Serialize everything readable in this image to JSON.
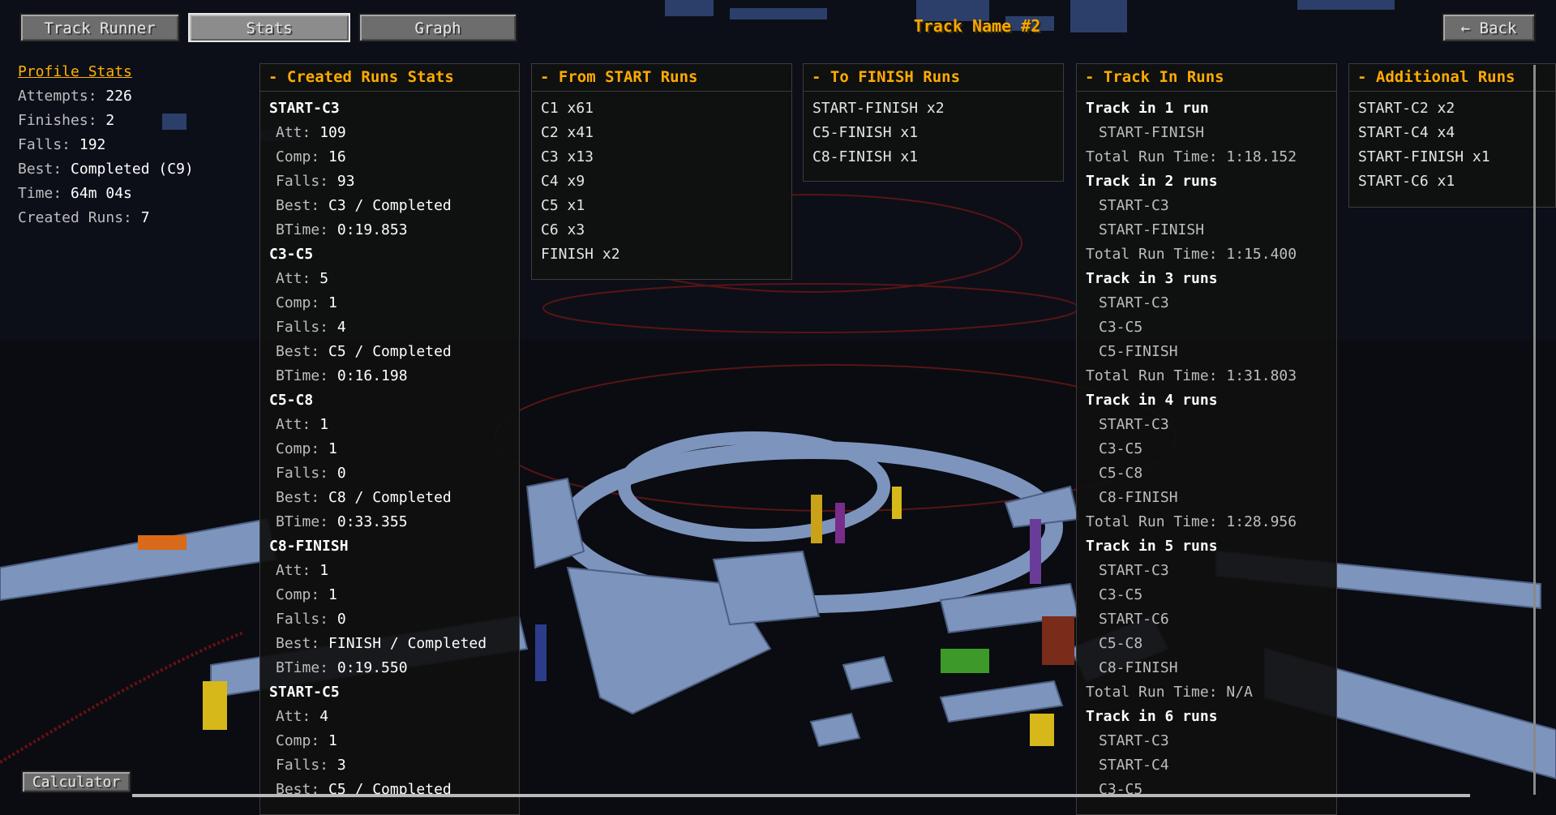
{
  "nav": {
    "track_runner": "Track Runner",
    "stats": "Stats",
    "graph": "Graph",
    "back": "← Back"
  },
  "track_title": "Track Name #2",
  "profile": {
    "header": "Profile Stats",
    "rows": [
      {
        "label": "Attempts: ",
        "value": "226"
      },
      {
        "label": "Finishes: ",
        "value": "2"
      },
      {
        "label": "Falls: ",
        "value": "192"
      },
      {
        "label": "Best: ",
        "value": "Completed (C9)"
      },
      {
        "label": "Time: ",
        "value": "64m 04s"
      },
      {
        "label": "Created Runs: ",
        "value": "7"
      }
    ]
  },
  "created_runs": {
    "header": "- Created Runs Stats",
    "runs": [
      {
        "name": "START-C3",
        "stats": [
          {
            "k": "Att: ",
            "v": "109"
          },
          {
            "k": "Comp: ",
            "v": "16"
          },
          {
            "k": "Falls: ",
            "v": "93"
          },
          {
            "k": "Best: ",
            "v": "C3 / Completed"
          },
          {
            "k": "BTime: ",
            "v": "0:19.853"
          }
        ]
      },
      {
        "name": "C3-C5",
        "stats": [
          {
            "k": "Att: ",
            "v": "5"
          },
          {
            "k": "Comp: ",
            "v": "1"
          },
          {
            "k": "Falls: ",
            "v": "4"
          },
          {
            "k": "Best: ",
            "v": "C5 / Completed"
          },
          {
            "k": "BTime: ",
            "v": "0:16.198"
          }
        ]
      },
      {
        "name": "C5-C8",
        "stats": [
          {
            "k": "Att: ",
            "v": "1"
          },
          {
            "k": "Comp: ",
            "v": "1"
          },
          {
            "k": "Falls: ",
            "v": "0"
          },
          {
            "k": "Best: ",
            "v": "C8 / Completed"
          },
          {
            "k": "BTime: ",
            "v": "0:33.355"
          }
        ]
      },
      {
        "name": "C8-FINISH",
        "stats": [
          {
            "k": "Att: ",
            "v": "1"
          },
          {
            "k": "Comp: ",
            "v": "1"
          },
          {
            "k": "Falls: ",
            "v": "0"
          },
          {
            "k": "Best: ",
            "v": "FINISH / Completed"
          },
          {
            "k": "BTime: ",
            "v": "0:19.550"
          }
        ]
      },
      {
        "name": "START-C5",
        "stats": [
          {
            "k": "Att: ",
            "v": "4"
          },
          {
            "k": "Comp: ",
            "v": "1"
          },
          {
            "k": "Falls: ",
            "v": "3"
          },
          {
            "k": "Best: ",
            "v": "C5 / Completed"
          }
        ]
      }
    ]
  },
  "from_start": {
    "header": "- From START Runs",
    "items": [
      "C1 x61",
      "C2 x41",
      "C3 x13",
      "C4 x9",
      "C5 x1",
      "C6 x3",
      "FINISH x2"
    ]
  },
  "to_finish": {
    "header": "- To FINISH Runs",
    "items": [
      "START-FINISH x2",
      "C5-FINISH x1",
      "C8-FINISH x1"
    ]
  },
  "track_in": {
    "header": "- Track In Runs",
    "groups": [
      {
        "title": "Track in 1 run",
        "segments": [
          "START-FINISH"
        ],
        "total": "Total Run Time: 1:18.152"
      },
      {
        "title": "Track in 2 runs",
        "segments": [
          "START-C3",
          "START-FINISH"
        ],
        "total": "Total Run Time: 1:15.400"
      },
      {
        "title": "Track in 3 runs",
        "segments": [
          "START-C3",
          "C3-C5",
          "C5-FINISH"
        ],
        "total": "Total Run Time: 1:31.803"
      },
      {
        "title": "Track in 4 runs",
        "segments": [
          "START-C3",
          "C3-C5",
          "C5-C8",
          "C8-FINISH"
        ],
        "total": "Total Run Time: 1:28.956"
      },
      {
        "title": "Track in 5 runs",
        "segments": [
          "START-C3",
          "C3-C5",
          "START-C6",
          "C5-C8",
          "C8-FINISH"
        ],
        "total": "Total Run Time: N/A"
      },
      {
        "title": "Track in 6 runs",
        "segments": [
          "START-C3",
          "START-C4",
          "C3-C5"
        ],
        "total": ""
      }
    ]
  },
  "additional": {
    "header": "- Additional Runs",
    "items": [
      "START-C2 x2",
      "START-C4 x4",
      "START-FINISH x1",
      "START-C6 x1"
    ]
  },
  "calculator": "Calculator"
}
